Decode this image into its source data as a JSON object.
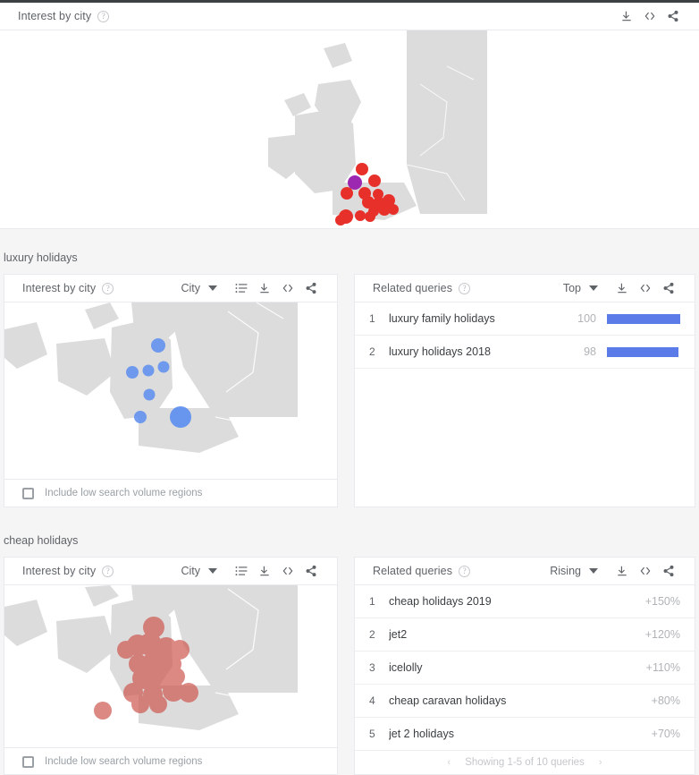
{
  "page": {
    "background": "#f5f5f5",
    "card_background": "#ffffff",
    "accent_bar_color": "#5b7be8",
    "muted_text_color": "#5f6368"
  },
  "top_panel": {
    "title": "Interest by city",
    "help_icon": "help-circle-icon",
    "tools": [
      {
        "name": "download-icon",
        "label": "Download"
      },
      {
        "name": "embed-code-icon",
        "label": "<>"
      },
      {
        "name": "share-icon",
        "label": "Share"
      }
    ],
    "map": {
      "region": "United Kingdom",
      "marker_color": "#e8302a",
      "highlight_marker_color": "#9c27b0",
      "land_color": "#dcdcdc"
    }
  },
  "sections": [
    {
      "keyword": "luxury holidays",
      "map_card": {
        "title": "Interest by city",
        "help_icon": "help-circle-icon",
        "dropdown": {
          "name": "geo-scope-dropdown",
          "value": "City"
        },
        "tools": [
          {
            "name": "list-view-icon",
            "label": "List view"
          },
          {
            "name": "download-icon",
            "label": "Download"
          },
          {
            "name": "embed-code-icon",
            "label": "<>"
          },
          {
            "name": "share-icon",
            "label": "Share"
          }
        ],
        "checkbox": {
          "label": "Include low search volume regions",
          "checked": false
        },
        "map": {
          "marker_color": "#5b8dee",
          "land_color": "#dcdcdc"
        }
      },
      "queries_card": {
        "title": "Related queries",
        "help_icon": "help-circle-icon",
        "dropdown": {
          "name": "queries-sort-dropdown",
          "value": "Top"
        },
        "tools": [
          {
            "name": "download-icon",
            "label": "Download"
          },
          {
            "name": "embed-code-icon",
            "label": "<>"
          },
          {
            "name": "share-icon",
            "label": "Share"
          }
        ],
        "mode": "top",
        "rows": [
          {
            "rank": "1",
            "query": "luxury family holidays",
            "value": "100",
            "bar_pct": 100
          },
          {
            "rank": "2",
            "query": "luxury holidays 2018",
            "value": "98",
            "bar_pct": 98
          }
        ],
        "pager": null
      }
    },
    {
      "keyword": "cheap holidays",
      "map_card": {
        "title": "Interest by city",
        "help_icon": "help-circle-icon",
        "dropdown": {
          "name": "geo-scope-dropdown",
          "value": "City"
        },
        "tools": [
          {
            "name": "list-view-icon",
            "label": "List view"
          },
          {
            "name": "download-icon",
            "label": "Download"
          },
          {
            "name": "embed-code-icon",
            "label": "<>"
          },
          {
            "name": "share-icon",
            "label": "Share"
          }
        ],
        "checkbox": {
          "label": "Include low search volume regions",
          "checked": false
        },
        "map": {
          "marker_color": "#cf5b54",
          "land_color": "#dcdcdc"
        }
      },
      "queries_card": {
        "title": "Related queries",
        "help_icon": "help-circle-icon",
        "dropdown": {
          "name": "queries-sort-dropdown",
          "value": "Rising"
        },
        "tools": [
          {
            "name": "download-icon",
            "label": "Download"
          },
          {
            "name": "embed-code-icon",
            "label": "<>"
          },
          {
            "name": "share-icon",
            "label": "Share"
          }
        ],
        "mode": "rising",
        "rows": [
          {
            "rank": "1",
            "query": "cheap holidays 2019",
            "value": "+150%"
          },
          {
            "rank": "2",
            "query": "jet2",
            "value": "+120%"
          },
          {
            "rank": "3",
            "query": "icelolly",
            "value": "+110%"
          },
          {
            "rank": "4",
            "query": "cheap caravan holidays",
            "value": "+80%"
          },
          {
            "rank": "5",
            "query": "jet 2 holidays",
            "value": "+70%"
          }
        ],
        "pager": {
          "prev": "‹",
          "text": "Showing 1-5 of 10 queries",
          "next": "›"
        }
      }
    }
  ]
}
